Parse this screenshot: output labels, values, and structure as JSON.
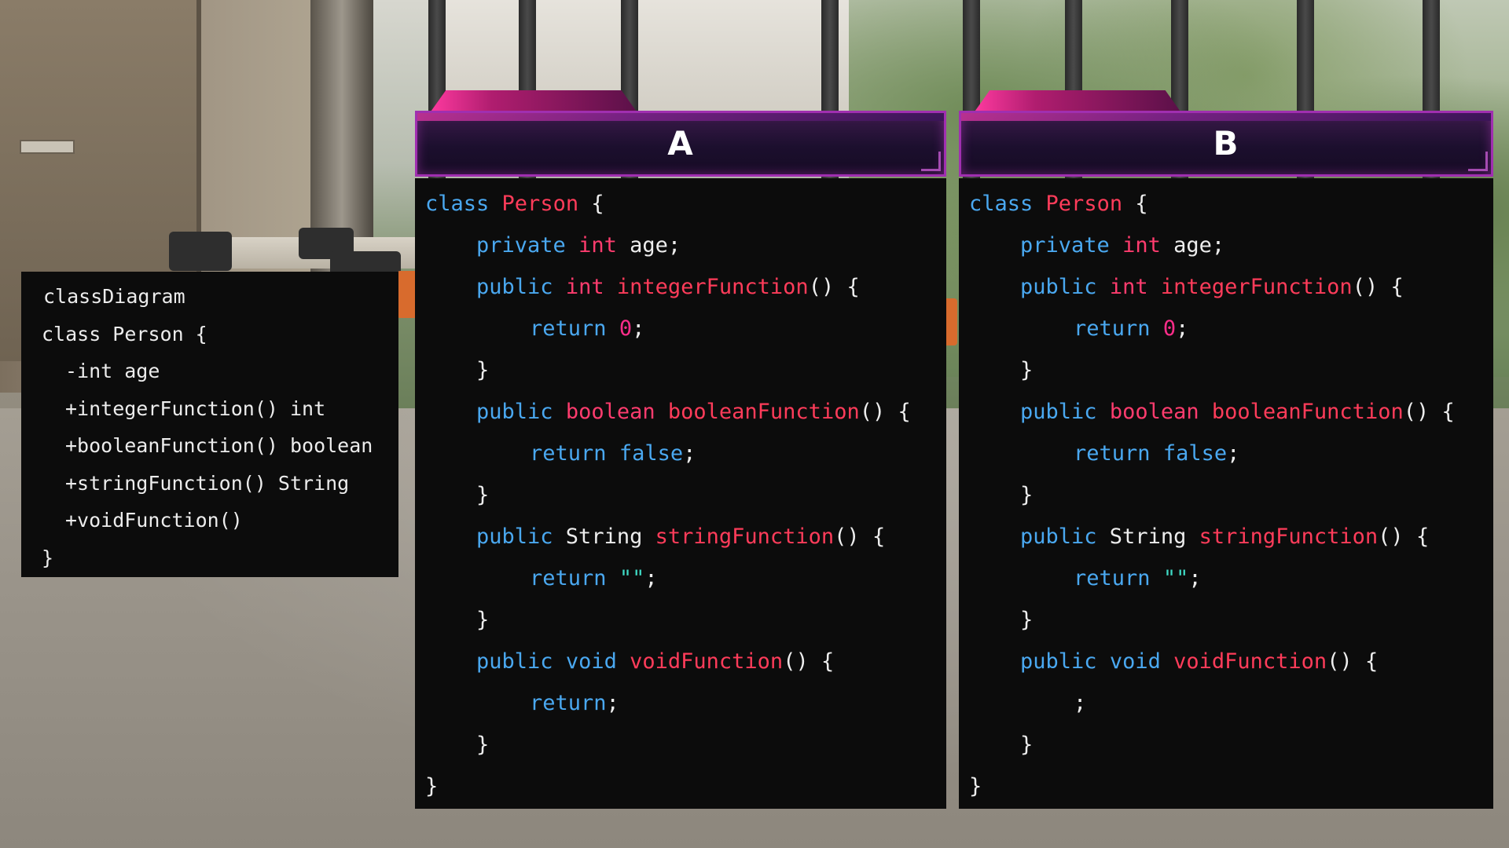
{
  "diagram": {
    "lines": [
      "classDiagram",
      "class Person {",
      "-int age",
      "+integerFunction() int",
      "+booleanFunction() boolean",
      "+stringFunction() String",
      "+voidFunction()",
      "}"
    ]
  },
  "colors": {
    "keyword": "#4aa8f0",
    "type": "#ff3c6e",
    "name": "#ff3c5a",
    "number": "#ff2d8a",
    "string": "#3fd9c4",
    "plain": "#ededed",
    "panel_bg": "#0c0c0c",
    "header_border": "#a02fb0"
  },
  "options": [
    {
      "letter": "A",
      "lines": [
        [
          {
            "t": "class",
            "c": "kw"
          },
          {
            "t": " ",
            "c": "pl"
          },
          {
            "t": "Person",
            "c": "nm"
          },
          {
            "t": " {",
            "c": "pl"
          }
        ],
        [
          {
            "t": "private",
            "c": "kw"
          },
          {
            "t": " ",
            "c": "pl"
          },
          {
            "t": "int",
            "c": "ty"
          },
          {
            "t": " age;",
            "c": "pl"
          }
        ],
        [
          {
            "t": "public",
            "c": "kw"
          },
          {
            "t": " ",
            "c": "pl"
          },
          {
            "t": "int",
            "c": "ty"
          },
          {
            "t": " ",
            "c": "pl"
          },
          {
            "t": "integerFunction",
            "c": "nm"
          },
          {
            "t": "() {",
            "c": "pl"
          }
        ],
        [
          {
            "t": "return",
            "c": "kw"
          },
          {
            "t": " ",
            "c": "pl"
          },
          {
            "t": "0",
            "c": "num"
          },
          {
            "t": ";",
            "c": "pl"
          }
        ],
        [
          {
            "t": "}",
            "c": "pl"
          }
        ],
        [
          {
            "t": "public",
            "c": "kw"
          },
          {
            "t": " ",
            "c": "pl"
          },
          {
            "t": "boolean",
            "c": "ty"
          },
          {
            "t": " ",
            "c": "pl"
          },
          {
            "t": "booleanFunction",
            "c": "nm"
          },
          {
            "t": "() {",
            "c": "pl"
          }
        ],
        [
          {
            "t": "return",
            "c": "kw"
          },
          {
            "t": " ",
            "c": "pl"
          },
          {
            "t": "false",
            "c": "kw"
          },
          {
            "t": ";",
            "c": "pl"
          }
        ],
        [
          {
            "t": "}",
            "c": "pl"
          }
        ],
        [
          {
            "t": "public",
            "c": "kw"
          },
          {
            "t": " String ",
            "c": "pl"
          },
          {
            "t": "stringFunction",
            "c": "nm"
          },
          {
            "t": "() {",
            "c": "pl"
          }
        ],
        [
          {
            "t": "return",
            "c": "kw"
          },
          {
            "t": " ",
            "c": "pl"
          },
          {
            "t": "\"\"",
            "c": "str"
          },
          {
            "t": ";",
            "c": "pl"
          }
        ],
        [
          {
            "t": "}",
            "c": "pl"
          }
        ],
        [
          {
            "t": "public",
            "c": "kw"
          },
          {
            "t": " ",
            "c": "pl"
          },
          {
            "t": "void",
            "c": "kw"
          },
          {
            "t": " ",
            "c": "pl"
          },
          {
            "t": "voidFunction",
            "c": "nm"
          },
          {
            "t": "() {",
            "c": "pl"
          }
        ],
        [
          {
            "t": "return",
            "c": "kw"
          },
          {
            "t": ";",
            "c": "pl"
          }
        ],
        [
          {
            "t": "}",
            "c": "pl"
          }
        ],
        [
          {
            "t": "}",
            "c": "pl"
          }
        ]
      ],
      "indents": [
        0,
        1,
        1,
        2,
        1,
        1,
        2,
        1,
        1,
        2,
        1,
        1,
        2,
        1,
        0
      ]
    },
    {
      "letter": "B",
      "lines": [
        [
          {
            "t": "class",
            "c": "kw"
          },
          {
            "t": " ",
            "c": "pl"
          },
          {
            "t": "Person",
            "c": "nm"
          },
          {
            "t": " {",
            "c": "pl"
          }
        ],
        [
          {
            "t": "private",
            "c": "kw"
          },
          {
            "t": " ",
            "c": "pl"
          },
          {
            "t": "int",
            "c": "ty"
          },
          {
            "t": " age;",
            "c": "pl"
          }
        ],
        [
          {
            "t": "public",
            "c": "kw"
          },
          {
            "t": " ",
            "c": "pl"
          },
          {
            "t": "int",
            "c": "ty"
          },
          {
            "t": " ",
            "c": "pl"
          },
          {
            "t": "integerFunction",
            "c": "nm"
          },
          {
            "t": "() {",
            "c": "pl"
          }
        ],
        [
          {
            "t": "return",
            "c": "kw"
          },
          {
            "t": " ",
            "c": "pl"
          },
          {
            "t": "0",
            "c": "num"
          },
          {
            "t": ";",
            "c": "pl"
          }
        ],
        [
          {
            "t": "}",
            "c": "pl"
          }
        ],
        [
          {
            "t": "public",
            "c": "kw"
          },
          {
            "t": " ",
            "c": "pl"
          },
          {
            "t": "boolean",
            "c": "ty"
          },
          {
            "t": " ",
            "c": "pl"
          },
          {
            "t": "booleanFunction",
            "c": "nm"
          },
          {
            "t": "() {",
            "c": "pl"
          }
        ],
        [
          {
            "t": "return",
            "c": "kw"
          },
          {
            "t": " ",
            "c": "pl"
          },
          {
            "t": "false",
            "c": "kw"
          },
          {
            "t": ";",
            "c": "pl"
          }
        ],
        [
          {
            "t": "}",
            "c": "pl"
          }
        ],
        [
          {
            "t": "public",
            "c": "kw"
          },
          {
            "t": " String ",
            "c": "pl"
          },
          {
            "t": "stringFunction",
            "c": "nm"
          },
          {
            "t": "() {",
            "c": "pl"
          }
        ],
        [
          {
            "t": "return",
            "c": "kw"
          },
          {
            "t": " ",
            "c": "pl"
          },
          {
            "t": "\"\"",
            "c": "str"
          },
          {
            "t": ";",
            "c": "pl"
          }
        ],
        [
          {
            "t": "}",
            "c": "pl"
          }
        ],
        [
          {
            "t": "public",
            "c": "kw"
          },
          {
            "t": " ",
            "c": "pl"
          },
          {
            "t": "void",
            "c": "kw"
          },
          {
            "t": " ",
            "c": "pl"
          },
          {
            "t": "voidFunction",
            "c": "nm"
          },
          {
            "t": "() {",
            "c": "pl"
          }
        ],
        [
          {
            "t": ";",
            "c": "pl"
          }
        ],
        [
          {
            "t": "}",
            "c": "pl"
          }
        ],
        [
          {
            "t": "}",
            "c": "pl"
          }
        ]
      ],
      "indents": [
        0,
        1,
        1,
        2,
        1,
        1,
        2,
        1,
        1,
        2,
        1,
        1,
        2,
        1,
        0
      ]
    }
  ]
}
